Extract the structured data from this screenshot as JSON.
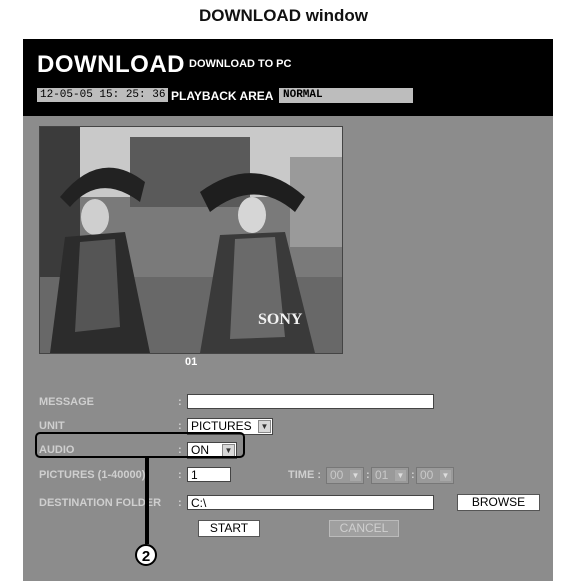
{
  "doc_title": "DOWNLOAD window",
  "header": {
    "title": "DOWNLOAD",
    "subtitle": "DOWNLOAD TO PC",
    "datetime": "12-05-05 15: 25: 36",
    "playback_label": "PLAYBACK AREA",
    "playback_value": "NORMAL"
  },
  "video": {
    "frame_number": "01",
    "watermark": "SONY"
  },
  "form": {
    "message": {
      "label": "MESSAGE",
      "colon": ":",
      "value": ""
    },
    "unit": {
      "label": "UNIT",
      "colon": ":",
      "value": "PICTURES"
    },
    "audio": {
      "label": "AUDIO",
      "colon": ":",
      "value": "ON"
    },
    "pictures": {
      "label": "PICTURES (1-40000)",
      "colon": ":",
      "value": "1"
    },
    "time": {
      "label": "TIME :",
      "hours": "00",
      "minutes": "01",
      "seconds": "00",
      "sep": ":"
    },
    "destination": {
      "label": "DESTINATION FOLDER",
      "colon": ":",
      "value": "C:\\"
    }
  },
  "buttons": {
    "browse": "BROWSE",
    "start": "START",
    "cancel": "CANCEL"
  },
  "callout": {
    "number": "2"
  },
  "colors": {
    "panel": "#8c8c8c",
    "header": "#000000"
  }
}
